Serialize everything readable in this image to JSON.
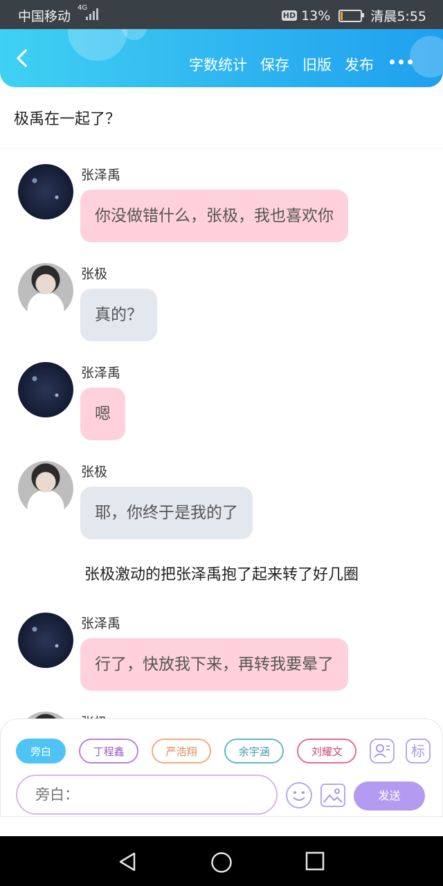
{
  "status_bar": {
    "carrier": "中国移动",
    "network": "4G",
    "hd": "HD",
    "battery_percent": "13%",
    "time": "清晨5:55",
    "battery_level": 0.13
  },
  "header": {
    "back_icon": "chevron-left-icon",
    "actions": [
      "字数统计",
      "保存",
      "旧版",
      "发布"
    ],
    "more_icon": "more-dots-icon"
  },
  "story_title": "极禹在一起了？",
  "messages": [
    {
      "speaker": "张泽禹",
      "text": "你没做错什么，张极，我也喜欢你",
      "style": "pink"
    },
    {
      "speaker": "张极",
      "text": "真的？",
      "style": "grey"
    },
    {
      "speaker": "张泽禹",
      "text": "嗯",
      "style": "pink"
    },
    {
      "speaker": "张极",
      "text": "耶，你终于是我的了",
      "style": "grey"
    },
    {
      "narration": "张极激动的把张泽禹抱了起来转了好几圈"
    },
    {
      "speaker": "张泽禹",
      "text": "行了，快放我下来，再转我要晕了",
      "style": "pink"
    },
    {
      "speaker": "张极",
      "text": ""
    }
  ],
  "composer": {
    "characters": [
      {
        "label": "旁白",
        "color": "#4fc4f4",
        "active": true
      },
      {
        "label": "丁程鑫",
        "color": "#b87fe0",
        "active": false
      },
      {
        "label": "严浩翔",
        "color": "#f5a97a",
        "active": false
      },
      {
        "label": "余宇涵",
        "color": "#5fb8c8",
        "active": false
      },
      {
        "label": "刘耀文",
        "color": "#e06a9a",
        "active": false
      }
    ],
    "character_icon": "character-card-icon",
    "tag_icon_label": "标",
    "input_placeholder": "旁白：",
    "emoji_icon": "emoji-icon",
    "image_icon": "image-icon",
    "send_label": "发送"
  },
  "system_nav": {
    "back": "back-triangle-icon",
    "home": "home-circle-icon",
    "recents": "recents-square-icon"
  }
}
